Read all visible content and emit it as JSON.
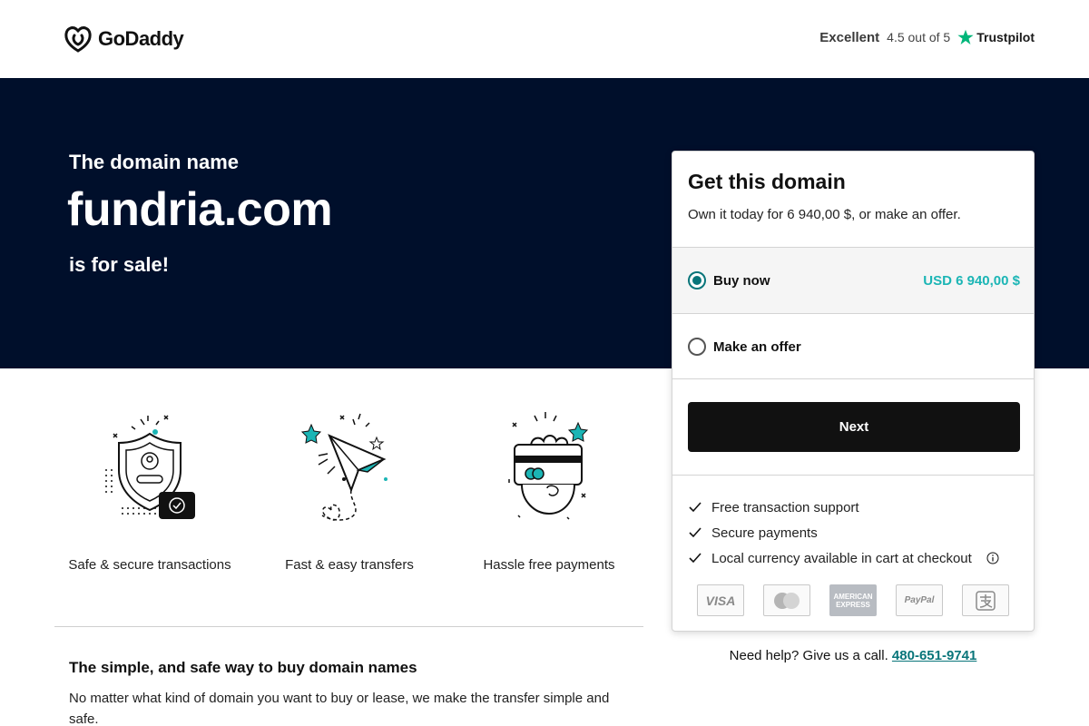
{
  "header": {
    "logo_text": "GoDaddy",
    "trust_rating": "Excellent",
    "trust_score": "4.5 out of 5",
    "trust_brand": "Trustpilot"
  },
  "hero": {
    "pre": "The domain name",
    "domain": "fundria.com",
    "post": "is for sale!"
  },
  "features": [
    {
      "label": "Safe & secure transactions",
      "icon": "shield-icon"
    },
    {
      "label": "Fast & easy transfers",
      "icon": "paper-plane-icon"
    },
    {
      "label": "Hassle free payments",
      "icon": "card-hand-icon"
    }
  ],
  "info": {
    "title": "The simple, and safe way to buy domain names",
    "text": "No matter what kind of domain you want to buy or lease, we make the transfer simple and safe."
  },
  "card": {
    "title": "Get this domain",
    "subtitle": "Own it today for 6 940,00 $, or make an offer.",
    "options": [
      {
        "label": "Buy now",
        "price": "USD 6 940,00 $",
        "selected": true
      },
      {
        "label": "Make an offer",
        "selected": false
      }
    ],
    "next_label": "Next",
    "checks": [
      "Free transaction support",
      "Secure payments",
      "Local currency available in cart at checkout"
    ],
    "payments": [
      "VISA",
      "mastercard",
      "AMERICAN EXPRESS",
      "PayPal",
      "alipay"
    ]
  },
  "help": {
    "text": "Need help? Give us a call.",
    "phone": "480-651-9741"
  },
  "colors": {
    "hero_bg": "#000f2b",
    "accent": "#09757a",
    "price": "#1bb5b5",
    "button": "#111111",
    "trustpilot_star": "#00b67a"
  }
}
